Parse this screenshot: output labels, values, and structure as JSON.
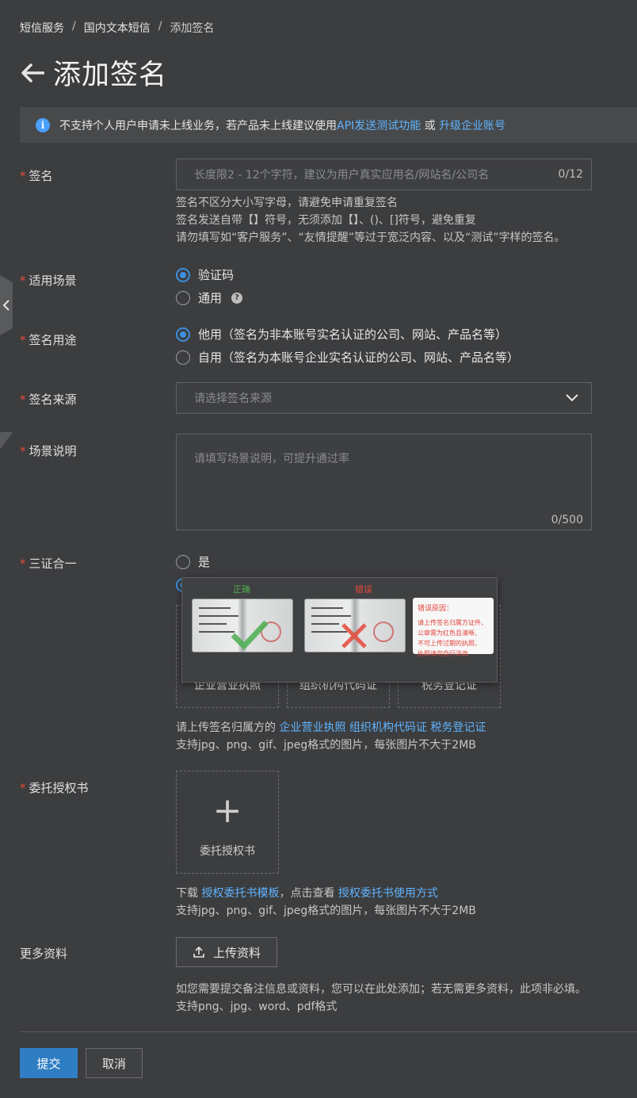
{
  "breadcrumb": {
    "item1": "短信服务",
    "item2": "国内文本短信",
    "current": "添加签名",
    "sep": "/"
  },
  "page": {
    "title": "添加签名"
  },
  "notice": {
    "text": "不支持个人用户申请未上线业务，若产品未上线建议使用",
    "link1": "API发送测试功能",
    "or": " 或 ",
    "link2": "升级企业账号"
  },
  "signature": {
    "label": "签名",
    "placeholder": "长度限2 - 12个字符，建议为用户真实应用名/网站名/公司名",
    "count": "0/12",
    "hint1": "签名不区分大小写字母，请避免申请重复签名",
    "hint2": "签名发送自带【】符号，无须添加【】、()、[]符号，避免重复",
    "hint3": "请勿填写如“客户服务”、“友情提醒”等过于宽泛内容、以及“测试”字样的签名。"
  },
  "scene": {
    "label": "适用场景",
    "option1": "验证码",
    "option2": "通用",
    "selected": "验证码"
  },
  "usage": {
    "label": "签名用途",
    "option1": "他用（签名为非本账号实名认证的公司、网站、产品名等）",
    "option2": "自用（签名为本账号企业实名认证的公司、网站、产品名等）",
    "selected": "他用"
  },
  "source": {
    "label": "签名来源",
    "placeholder": "请选择签名来源"
  },
  "description": {
    "label": "场景说明",
    "placeholder": "请填写场景说明，可提升通过率",
    "count": "0/500"
  },
  "three_in_one": {
    "label": "三证合一",
    "option_yes": "是",
    "uploads": [
      "企业营业执照",
      "组织机构代码证",
      "税务登记证"
    ],
    "hint_prefix": "请上传签名归属方的 ",
    "hint_links": [
      "企业营业执照",
      "组织机构代码证",
      "税务登记证"
    ],
    "format_hint": "支持jpg、png、gif、jpeg格式的图片，每张图片不大于2MB",
    "popover": {
      "correct": "正确",
      "wrong": "错误",
      "reason_title": "错误原因：",
      "reason_lines": [
        "请上传签名归属方证件、",
        "公章需为红色且清晰、",
        "不可上传过期的执照、",
        "执照请勿自行涂改"
      ]
    }
  },
  "authorization": {
    "label": "委托授权书",
    "upload_label": "委托授权书",
    "hint_prefix": "下载 ",
    "template_link": "授权委托书模板",
    "hint_mid": "，点击查看 ",
    "usage_link": "授权委托书使用方式",
    "format_hint": "支持jpg、png、gif、jpeg格式的图片，每张图片不大于2MB"
  },
  "more": {
    "label": "更多资料",
    "button": "上传资料",
    "hint1": "如您需要提交备注信息或资料，您可以在此处添加；若无需更多资料，此项非必填。",
    "hint2": "支持png、jpg、word、pdf格式"
  },
  "actions": {
    "submit": "提交",
    "cancel": "取消"
  },
  "colors": {
    "accent": "#2f7ec4",
    "link": "#5fb4ff",
    "required": "#e5493a",
    "background": "#3c3d3f"
  }
}
